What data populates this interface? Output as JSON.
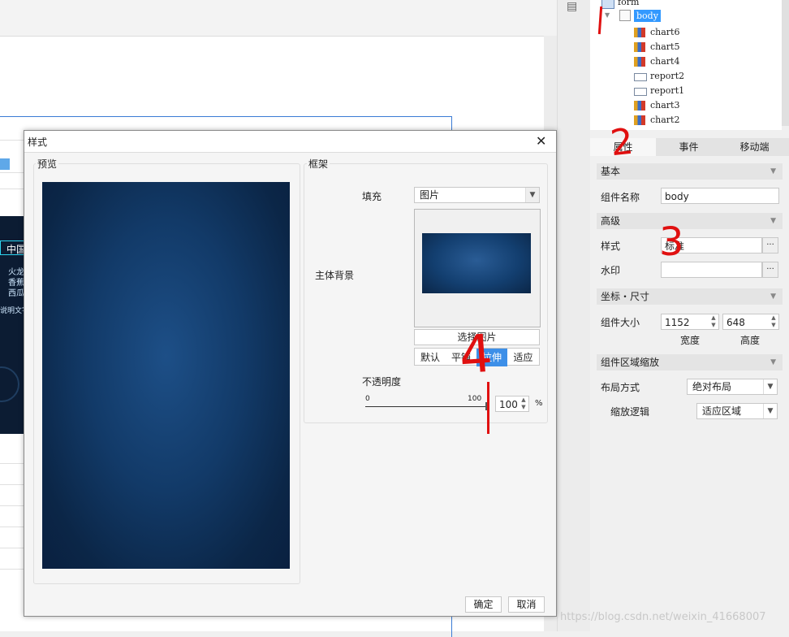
{
  "tree": {
    "root": "form",
    "selected": "body",
    "children": [
      "chart6",
      "chart5",
      "chart4",
      "report2",
      "report1",
      "chart3",
      "chart2"
    ]
  },
  "tabs": [
    "属性",
    "事件",
    "移动端"
  ],
  "sections": {
    "basic": "基本",
    "advanced": "高级",
    "coords": "坐标・尺寸",
    "zoom": "组件区域缩放"
  },
  "props": {
    "name_label": "组件名称",
    "name_value": "body",
    "style_label": "样式",
    "style_value": "标准",
    "watermark_label": "水印",
    "watermark_value": "",
    "dots": "···",
    "size_label": "组件大小",
    "width": "1152",
    "height": "648",
    "width_label": "宽度",
    "height_label": "高度",
    "layout_label": "布局方式",
    "layout_value": "绝对布局",
    "zoom_label": "缩放逻辑",
    "zoom_value": "适应区域"
  },
  "canvas": {
    "strip_lines": [
      "中国",
      "火龙",
      "香蕉",
      "西瓜",
      "说明文字"
    ]
  },
  "dialog": {
    "title": "样式",
    "close": "✕",
    "preview_label": "预览",
    "frame_label": "框架",
    "fill_label": "填充",
    "fill_value": "图片",
    "bg_label": "主体背景",
    "choose_image": "选择图片",
    "modes": [
      "默认",
      "平铺",
      "拉伸",
      "适应"
    ],
    "active_mode": "拉伸",
    "opacity_label": "不透明度",
    "slider_min": "0",
    "slider_max": "100",
    "opacity_value": "100",
    "opacity_unit": "%",
    "ok": "确定",
    "cancel": "取消"
  },
  "watermark_text": "https://blog.csdn.net/weixin_41668007",
  "annotations": [
    "2",
    "3",
    "4"
  ],
  "colors": {
    "accent": "#3d8fe8",
    "annotation": "#e01010",
    "selected": "#3399ff"
  }
}
